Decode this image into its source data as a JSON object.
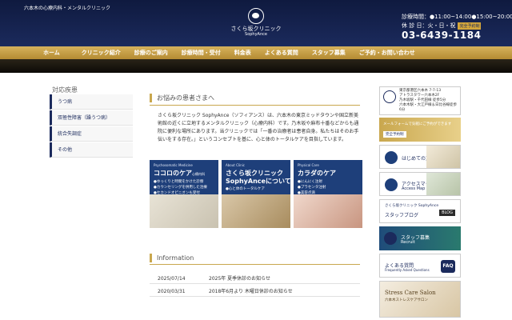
{
  "header": {
    "tagline": "六本木の心療内科・メンタルクリニック",
    "clinic_name": "さくら坂クリニック",
    "clinic_name_en": "SophyAnce",
    "hours": "診療時間：●11:00~14:00●15:00~20:00",
    "closed_days": "休 診 日：火・日・祝",
    "reserve_tag": "完全予約制",
    "phone": "03-6439-1184"
  },
  "nav": {
    "items": [
      "ホーム",
      "クリニック紹介",
      "診療のご案内",
      "診療時間・受付",
      "料金表",
      "よくある質問",
      "スタッフ募集",
      "ご予約・お問い合わせ"
    ]
  },
  "sidebar": {
    "title": "対応疾患",
    "items": [
      "うつ病",
      "双極性障害（躁うつ病）",
      "統合失調症",
      "その他"
    ]
  },
  "main": {
    "intro_title": "お悩みの患者さまへ",
    "intro_text": "さくら坂クリニック SophyAnce（ソフィアンス）は、六本木の東京ミッドタウンや国立新美術館の近くに立地するメンタルクリニック（心療内科）です。乃木坂や麻布十番などからも通院に便利な場所にあります。当クリニックでは「一番の治療者は患者自身。私たちはそのお手伝いをする存在。」というコンセプトを基に、心と体のトータルケアを目指しています。",
    "cards": [
      {
        "en": "Psychosomatic Medicine",
        "title": "ココロのケア",
        "small": "心療内科",
        "lines": [
          "●ゆっくりと時間をかけた診察",
          "●カウンセリングを併用した治療",
          "●セカンドオピニオンも受付"
        ]
      },
      {
        "en": "About Clinic",
        "title": "さくら坂クリニック",
        "title2": "SophyAnceについて",
        "lines": [
          "●心と体のトータルケア"
        ]
      },
      {
        "en": "Physical Care",
        "title": "カラダのケア",
        "lines": [
          "●にんにく注射",
          "●プラセンタ注射",
          "●美容点滴"
        ]
      }
    ],
    "info_title": "Information",
    "news": [
      {
        "date": "2025/07/14",
        "text": "2025年 夏季休診のお知らせ"
      },
      {
        "date": "2020/03/31",
        "text": "2018年6月より 木曜日休診のお知らせ"
      }
    ]
  },
  "right": {
    "address": [
      "東京都港区六本木 7-7-13",
      "アトラスタワー六本木2F",
      "乃木坂駅・千代田線 徒歩5分",
      "六本木駅・大江戸線＆日比谷線徒歩6分"
    ],
    "web_text": "メールフォームで気軽にご予約ができます",
    "web_btn": "完全予約制",
    "beginner": "はじめての方へ",
    "access_label": "アクセスマップ",
    "access_sub": "Access Map",
    "blog_top": "さくら坂クリニック SophyAnce",
    "blog_label": "スタッフブログ",
    "blog_tag": "BLOG",
    "recruit_label": "スタッフ募集",
    "recruit_sub": "Recruit",
    "faq_label": "よくある質問",
    "faq_sub": "Frequently Asked Questions",
    "faq_tag": "FAQ",
    "salon_name": "Stress Care Salon",
    "salon_sub": "六本木ストレスケアサロン"
  }
}
